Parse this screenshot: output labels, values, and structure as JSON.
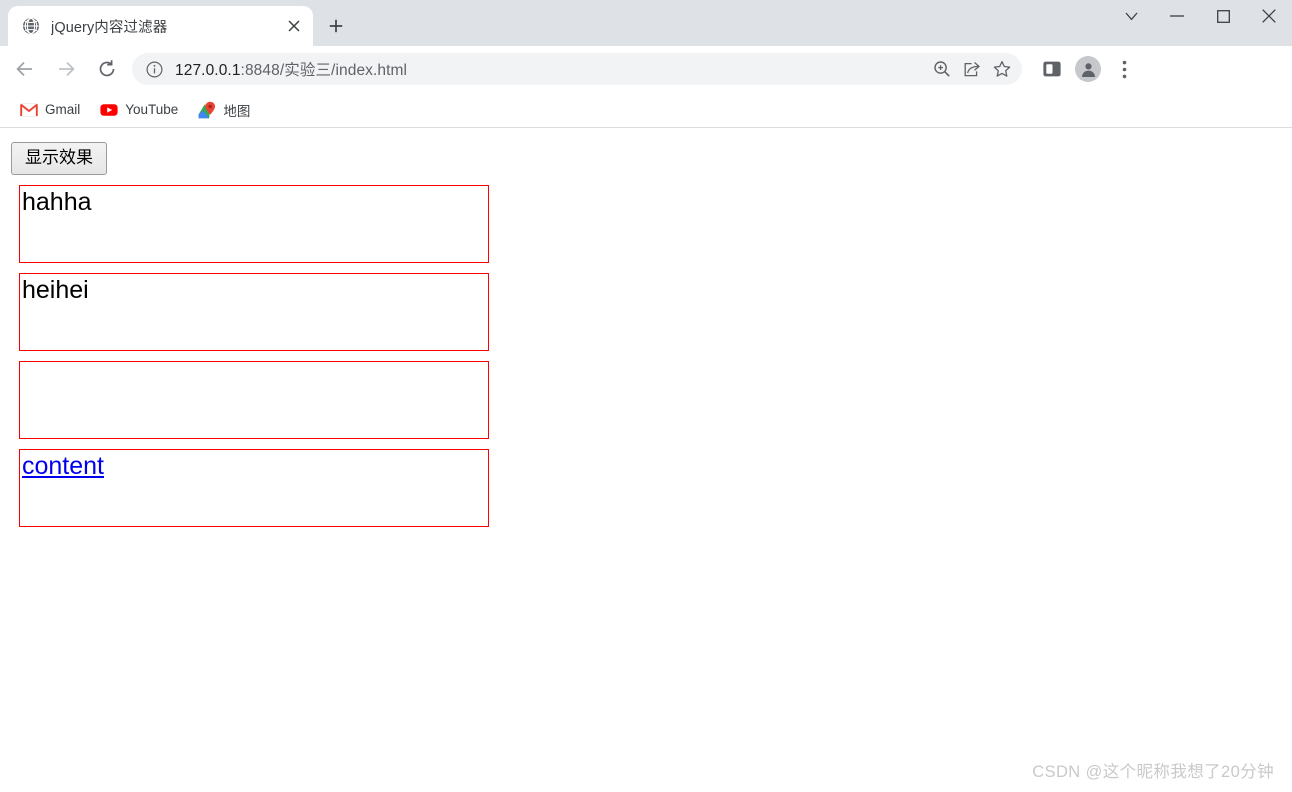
{
  "window": {
    "controls": [
      {
        "name": "tab-search",
        "icon": "chevron-down-icon",
        "label": ""
      },
      {
        "name": "minimize",
        "icon": "minimize-icon",
        "label": ""
      },
      {
        "name": "maximize",
        "icon": "maximize-icon",
        "label": ""
      },
      {
        "name": "close",
        "icon": "close-icon",
        "label": ""
      }
    ]
  },
  "tabstrip": {
    "tabs": [
      {
        "title": "jQuery内容过滤器",
        "favicon": "globe-icon",
        "active": true
      }
    ],
    "close_label": "×",
    "newtab_label": "+"
  },
  "toolbar": {
    "back_icon": "arrow-left-icon",
    "forward_icon": "arrow-right-icon",
    "reload_icon": "reload-icon",
    "info_icon": "info-circle-icon",
    "url": {
      "host": "127.0.0.1",
      "port": ":8848",
      "path": "/实验三/index.html",
      "full": "127.0.0.1:8848/实验三/index.html"
    },
    "trailing_icons": [
      {
        "name": "zoom-in-icon"
      },
      {
        "name": "share-icon"
      },
      {
        "name": "star-icon"
      }
    ],
    "right_icons": [
      {
        "name": "side-panel-icon"
      },
      {
        "name": "profile-avatar-icon"
      },
      {
        "name": "more-menu-icon"
      }
    ]
  },
  "bookmarks": {
    "items": [
      {
        "label": "Gmail",
        "icon": "gmail-icon"
      },
      {
        "label": "YouTube",
        "icon": "youtube-icon"
      },
      {
        "label": "地图",
        "icon": "google-maps-icon"
      }
    ]
  },
  "page": {
    "button_label": "显示效果",
    "boxes": [
      {
        "text": "hahha",
        "type": "text"
      },
      {
        "text": "heihei",
        "type": "text"
      },
      {
        "text": "",
        "type": "empty"
      },
      {
        "text": "content",
        "type": "link"
      }
    ],
    "border_color": "#ff0000",
    "link_color": "#0000ee"
  },
  "watermark": {
    "text": "CSDN @这个昵称我想了20分钟"
  }
}
